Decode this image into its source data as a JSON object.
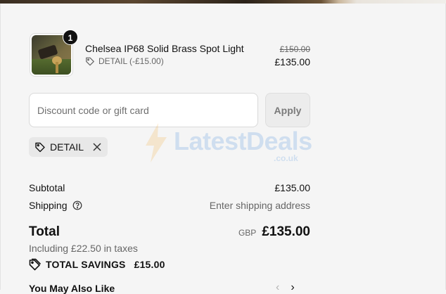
{
  "product": {
    "quantity": "1",
    "name": "Chelsea IP68 Solid Brass Spot Light",
    "discount_label": "DETAIL (-£15.00)",
    "original_price": "£150.00",
    "price": "£135.00"
  },
  "discount": {
    "placeholder": "Discount code or gift card",
    "apply_label": "Apply",
    "applied_code": "DETAIL"
  },
  "watermark": {
    "text": "LatestDeals",
    "sub": ".co.uk"
  },
  "summary": {
    "subtotal_label": "Subtotal",
    "subtotal_value": "£135.00",
    "shipping_label": "Shipping",
    "shipping_value": "Enter shipping address",
    "total_label": "Total",
    "currency": "GBP",
    "total_value": "£135.00",
    "taxes_text": "Including £22.50 in taxes",
    "savings_label": "TOTAL SAVINGS",
    "savings_value": "£15.00"
  },
  "recommendations": {
    "title": "You May Also Like",
    "prev_glyph": "‹",
    "next_glyph": "›"
  },
  "colors": {
    "background": "#f5f5f5",
    "badge": "#111111",
    "chip": "#e8e8e8",
    "watermark": "#2b7bd6"
  }
}
